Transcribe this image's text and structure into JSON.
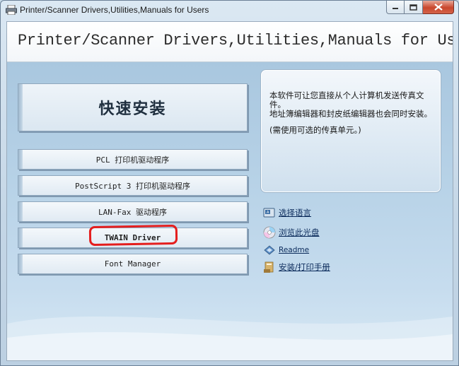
{
  "window": {
    "title": "Printer/Scanner Drivers,Utilities,Manuals for Users",
    "controls": {
      "minimize": "minimize",
      "maximize": "maximize",
      "close": "close"
    }
  },
  "header": {
    "title": "Printer/Scanner Drivers,Utilities,Manuals for Users"
  },
  "main": {
    "quick_install_label": "快速安装",
    "buttons": [
      {
        "label": "PCL 打印机驱动程序"
      },
      {
        "label": "PostScript 3 打印机驱动程序"
      },
      {
        "label": "LAN-Fax 驱动程序"
      },
      {
        "label": "TWAIN Driver"
      },
      {
        "label": "Font Manager"
      }
    ]
  },
  "info": {
    "line1": "本软件可让您直接从个人计算机发送传真文件。",
    "line2": "地址簿编辑器和封皮纸编辑器也会同时安装。",
    "line3": "(需使用可选的传真单元。)"
  },
  "links": [
    {
      "label": "选择语言",
      "icon": "language-icon"
    },
    {
      "label": "浏览此光盘",
      "icon": "cd-icon"
    },
    {
      "label": "Readme",
      "icon": "readme-icon"
    },
    {
      "label": "安装/打印手册",
      "icon": "manual-icon"
    }
  ],
  "colors": {
    "highlight": "#e41e1e",
    "link": "#0a2a5a"
  }
}
